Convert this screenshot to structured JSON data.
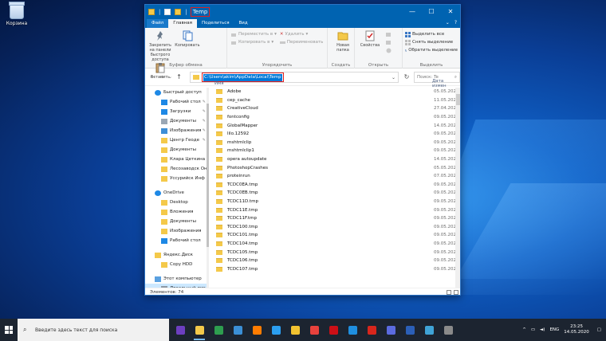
{
  "desktop": {
    "recycle_bin_label": "Корзина"
  },
  "window": {
    "title": "Temp",
    "controls": {
      "minimize": "—",
      "maximize": "☐",
      "close": "✕"
    }
  },
  "ribbon_tabs": [
    {
      "label": "Файл"
    },
    {
      "label": "Главная"
    },
    {
      "label": "Поделиться"
    },
    {
      "label": "Вид"
    }
  ],
  "ribbon": {
    "clipboard": {
      "pin_label": "Закрепить на панели быстрого доступа",
      "copy_label": "Копировать",
      "paste_label": "Вставить",
      "group_label": "Буфер обмена"
    },
    "organize": {
      "move_label": "Переместить в",
      "copy_to_label": "Копировать в",
      "delete_label": "Удалить",
      "rename_label": "Переименовать",
      "group_label": "Упорядочить"
    },
    "create": {
      "new_folder_label": "Новая папка",
      "group_label": "Создать"
    },
    "open": {
      "properties_label": "Свойства",
      "group_label": "Открыть"
    },
    "select": {
      "select_all": "Выделить все",
      "select_none": "Снять выделение",
      "invert": "Обратить выделение",
      "group_label": "Выделить"
    }
  },
  "address": {
    "path": "C:\\Users\\akim\\AppData\\Local\\Temp",
    "search_placeholder": "Поиск: Te"
  },
  "sidebar": [
    {
      "label": "Быстрый доступ",
      "icon": "star-icon",
      "color": "#1e88e5"
    },
    {
      "label": "Рабочий стол",
      "icon": "desktop-icon",
      "color": "#1e88e5",
      "pin": true
    },
    {
      "label": "Загрузки",
      "icon": "download-icon",
      "color": "#1e88e5",
      "pin": true
    },
    {
      "label": "Документы",
      "icon": "document-icon",
      "color": "#9aa7b5",
      "pin": true
    },
    {
      "label": "Изображения",
      "icon": "image-icon",
      "color": "#3d8ed6",
      "pin": true
    },
    {
      "label": "Центр Геоде",
      "icon": "folder-icon",
      "color": "#f4c94a",
      "pin": true
    },
    {
      "label": "Документы",
      "icon": "folder-icon",
      "color": "#f4c94a"
    },
    {
      "label": "Клара Цеткина",
      "icon": "folder-icon",
      "color": "#f4c94a"
    },
    {
      "label": "Лесозаводск Он",
      "icon": "folder-icon",
      "color": "#f4c94a"
    },
    {
      "label": "Уссурийск Инф",
      "icon": "folder-icon",
      "color": "#f4c94a"
    },
    {
      "label": "",
      "icon": "spacer",
      "color": ""
    },
    {
      "label": "OneDrive",
      "icon": "cloud-icon",
      "color": "#1e88e5"
    },
    {
      "label": "Desktop",
      "icon": "folder-icon",
      "color": "#f4c94a"
    },
    {
      "label": "Вложения",
      "icon": "folder-icon",
      "color": "#f4c94a"
    },
    {
      "label": "Документы",
      "icon": "folder-icon",
      "color": "#f4c94a"
    },
    {
      "label": "Изображения",
      "icon": "folder-icon",
      "color": "#f4c94a"
    },
    {
      "label": "Рабочий стол",
      "icon": "folder-icon",
      "color": "#1e88e5"
    },
    {
      "label": "",
      "icon": "spacer",
      "color": ""
    },
    {
      "label": "Яндекс.Диск",
      "icon": "yandex-disk-icon",
      "color": "#f4c94a"
    },
    {
      "label": "Copy HDD",
      "icon": "folder-icon",
      "color": "#f4c94a"
    },
    {
      "label": "",
      "icon": "spacer",
      "color": ""
    },
    {
      "label": "Этот компьютер",
      "icon": "computer-icon",
      "color": "#5aa0e0"
    },
    {
      "label": "Локальный дис",
      "icon": "drive-icon",
      "color": "#8e9aa6",
      "selected": true
    }
  ],
  "list": {
    "col_name": "Имя",
    "col_date": "Дата измен",
    "rows": [
      {
        "name": "Adobe",
        "date": "05.05.2020"
      },
      {
        "name": "cep_cache",
        "date": "11.05.2020"
      },
      {
        "name": "CreativeCloud",
        "date": "27.04.2020"
      },
      {
        "name": "fontconfig",
        "date": "09.05.2020"
      },
      {
        "name": "GlobalMapper",
        "date": "14.05.2020"
      },
      {
        "name": "lilo.12592",
        "date": "09.05.2020"
      },
      {
        "name": "mshtmlclip",
        "date": "09.05.2020"
      },
      {
        "name": "mshtmlclip1",
        "date": "09.05.2020"
      },
      {
        "name": "opera autoupdate",
        "date": "14.05.2020"
      },
      {
        "name": "PhotoshopCrashes",
        "date": "05.05.2020"
      },
      {
        "name": "proteinrun",
        "date": "07.05.2020"
      },
      {
        "name": "TCDC0EA.tmp",
        "date": "09.05.2020"
      },
      {
        "name": "TCDC0EB.tmp",
        "date": "09.05.2020"
      },
      {
        "name": "TCDC11D.tmp",
        "date": "09.05.2020"
      },
      {
        "name": "TCDC11E.tmp",
        "date": "09.05.2020"
      },
      {
        "name": "TCDC11F.tmp",
        "date": "09.05.2020"
      },
      {
        "name": "TCDC100.tmp",
        "date": "09.05.2020"
      },
      {
        "name": "TCDC101.tmp",
        "date": "09.05.2020"
      },
      {
        "name": "TCDC104.tmp",
        "date": "09.05.2020"
      },
      {
        "name": "TCDC105.tmp",
        "date": "09.05.2020"
      },
      {
        "name": "TCDC106.tmp",
        "date": "09.05.2020"
      },
      {
        "name": "TCDC107.tmp",
        "date": "09.05.2020"
      }
    ]
  },
  "status": {
    "count_text": "Элементов: 74"
  },
  "taskbar": {
    "search_placeholder": "Введите здесь текст для поиска",
    "apps": [
      {
        "name": "chat-app-icon",
        "color": "#6d3fc0"
      },
      {
        "name": "file-explorer-icon",
        "color": "#f4c94a",
        "active": true
      },
      {
        "name": "maps-app-icon",
        "color": "#2e9e4f"
      },
      {
        "name": "globe-app-icon",
        "color": "#3b8fd6"
      },
      {
        "name": "illustrator-icon",
        "color": "#ff7c00"
      },
      {
        "name": "photoshop-icon",
        "color": "#2b9ef0"
      },
      {
        "name": "archicad-icon",
        "color": "#f2c230"
      },
      {
        "name": "browser-icon",
        "color": "#e7423d"
      },
      {
        "name": "opera-icon",
        "color": "#cc0f16"
      },
      {
        "name": "edge-icon",
        "color": "#1f8fe0"
      },
      {
        "name": "acrobat-icon",
        "color": "#d8261c"
      },
      {
        "name": "media-app-icon",
        "color": "#5b6be0"
      },
      {
        "name": "word-icon",
        "color": "#2b5fb7"
      },
      {
        "name": "screen-app-icon",
        "color": "#3fa3d6"
      },
      {
        "name": "settings-app-icon",
        "color": "#8a8a8a"
      }
    ],
    "language": "ENG",
    "time": "23:25",
    "date": "14.05.2020"
  }
}
